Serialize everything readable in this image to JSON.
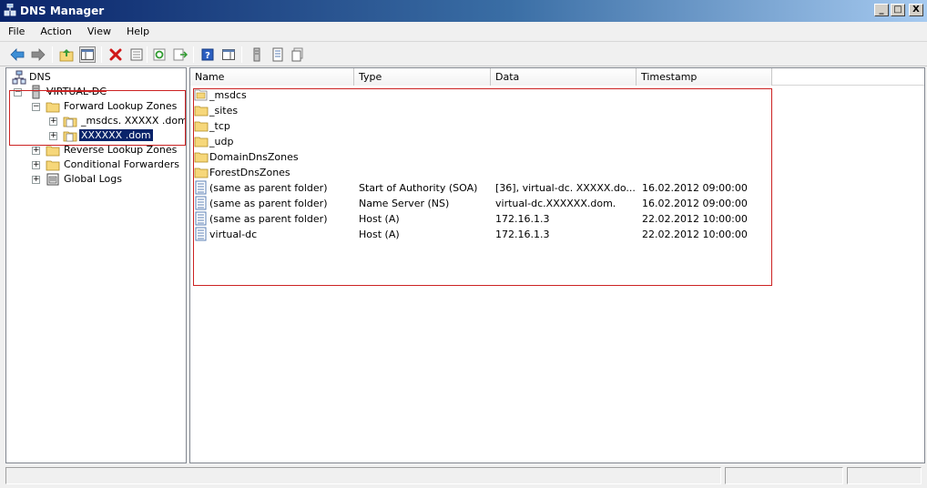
{
  "window": {
    "title": "DNS Manager",
    "controls": {
      "minimize": "_",
      "maximize": "□",
      "close": "X"
    }
  },
  "menu": [
    "File",
    "Action",
    "View",
    "Help"
  ],
  "toolbar_icons": [
    "back-arrow-icon",
    "forward-arrow-icon",
    "up-folder-icon",
    "show-hide-tree-icon",
    "delete-icon",
    "properties-icon",
    "refresh-icon",
    "export-list-icon",
    "help-icon",
    "show-hide-action-pane-icon",
    "dns-server-icon",
    "zone-record-icon",
    "zone-list-icon"
  ],
  "tree": {
    "root": "DNS",
    "server": "VIRTUAL-DC",
    "forward_zones": "Forward Lookup Zones",
    "zone_msdcs": "_msdcs. XXXXX .dom",
    "zone_main": "XXXXXX .dom",
    "reverse_zones": "Reverse Lookup Zones",
    "conditional_forwarders": "Conditional Forwarders",
    "global_logs": "Global Logs",
    "expander_plus": "+",
    "expander_minus": "−"
  },
  "list": {
    "columns": [
      "Name",
      "Type",
      "Data",
      "Timestamp"
    ],
    "rows": [
      {
        "name": "_msdcs",
        "type": "",
        "data": "",
        "timestamp": "",
        "icon": "delegated-folder-icon"
      },
      {
        "name": "_sites",
        "type": "",
        "data": "",
        "timestamp": "",
        "icon": "folder-icon"
      },
      {
        "name": "_tcp",
        "type": "",
        "data": "",
        "timestamp": "",
        "icon": "folder-icon"
      },
      {
        "name": "_udp",
        "type": "",
        "data": "",
        "timestamp": "",
        "icon": "folder-icon"
      },
      {
        "name": "DomainDnsZones",
        "type": "",
        "data": "",
        "timestamp": "",
        "icon": "folder-icon"
      },
      {
        "name": "ForestDnsZones",
        "type": "",
        "data": "",
        "timestamp": "",
        "icon": "folder-icon"
      },
      {
        "name": "(same as parent folder)",
        "type": "Start of Authority (SOA)",
        "data": "[36], virtual-dc.  XXXXX.do...",
        "timestamp": "16.02.2012 09:00:00",
        "icon": "record-icon"
      },
      {
        "name": "(same as parent folder)",
        "type": "Name Server (NS)",
        "data": "virtual-dc.XXXXXX.dom.",
        "timestamp": "16.02.2012 09:00:00",
        "icon": "record-icon"
      },
      {
        "name": "(same as parent folder)",
        "type": "Host (A)",
        "data": "172.16.1.3",
        "timestamp": "22.02.2012 10:00:00",
        "icon": "record-icon"
      },
      {
        "name": "virtual-dc",
        "type": "Host (A)",
        "data": "172.16.1.3",
        "timestamp": "22.02.2012 10:00:00",
        "icon": "record-icon"
      }
    ]
  },
  "status": {
    "panel1": "",
    "panel2": "",
    "panel3": ""
  },
  "colors": {
    "selection": "#0a246a",
    "annotation_red": "#cc2222",
    "folder": "#f6d77a"
  }
}
